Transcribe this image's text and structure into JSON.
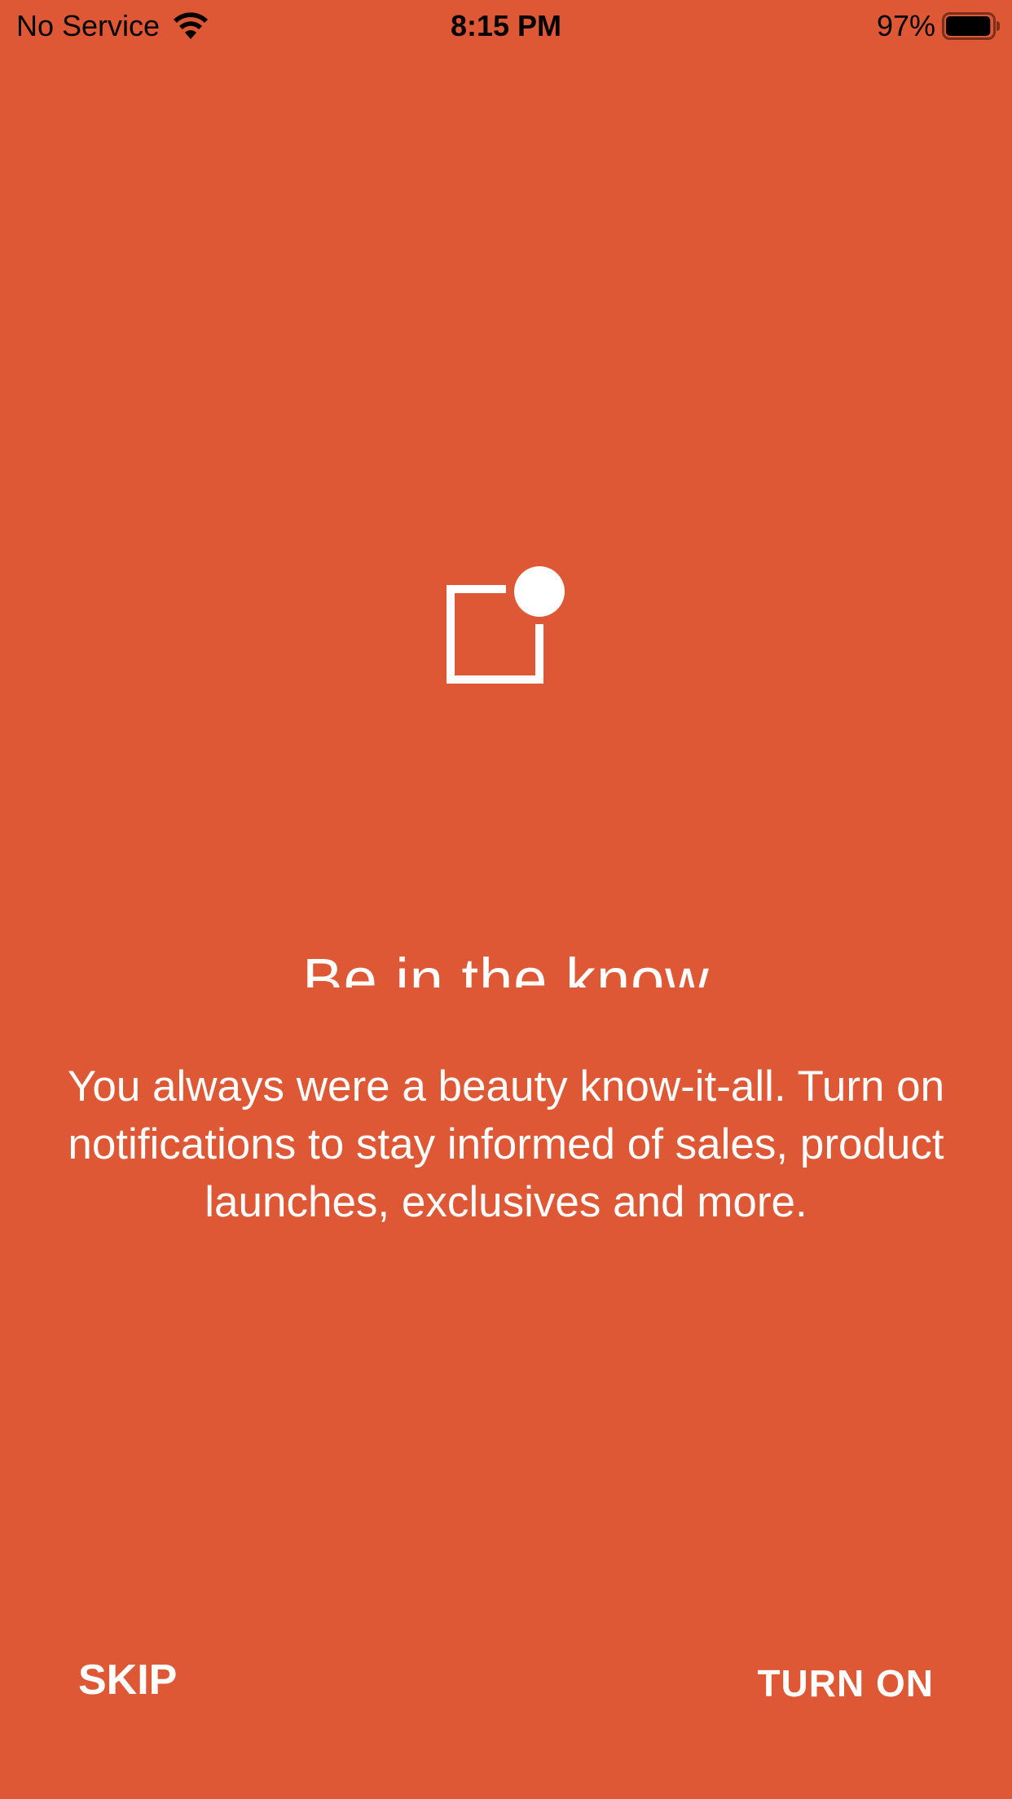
{
  "status_bar": {
    "carrier": "No Service",
    "time": "8:15 PM",
    "battery_percent": "97%",
    "wifi_icon": "wifi-icon",
    "battery_icon": "battery-icon",
    "battery_level": 0.97
  },
  "onboarding": {
    "icon": "notification-badge-icon",
    "title": "Be in the know",
    "body": "You always were a beauty know-it-all. Turn on notifications to stay informed of sales, product launches, exclusives and more."
  },
  "actions": {
    "skip_label": "SKIP",
    "turn_on_label": "TURN ON"
  },
  "colors": {
    "background": "#DE5836",
    "foreground": "#FFFFFF",
    "status_text": "#000000"
  }
}
